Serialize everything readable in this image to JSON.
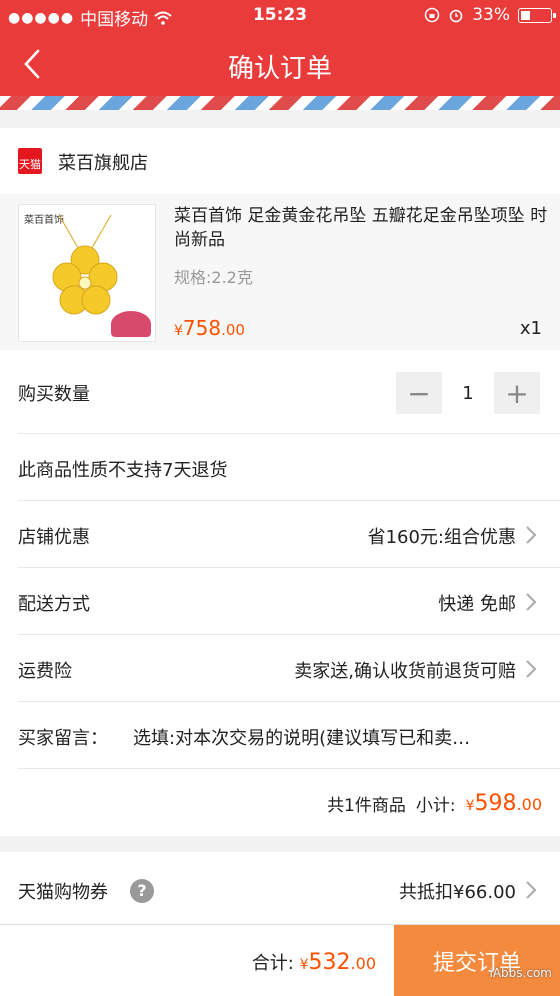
{
  "status_bar": {
    "carrier": "中国移动",
    "time": "15:23",
    "battery": "33%"
  },
  "nav": {
    "title": "确认订单"
  },
  "shop": {
    "badge": "天猫",
    "name": "菜百旗舰店"
  },
  "product": {
    "thumb_brand": "菜百首饰",
    "title": "菜百首饰 足金黄金花吊坠 五瓣花足金吊坠项坠 时尚新品",
    "spec": "规格:2.2克",
    "price_symbol": "¥",
    "price_int": "758",
    "price_dec": ".00",
    "quantity": "x1"
  },
  "rows": {
    "buy_qty_label": "购买数量",
    "buy_qty_value": "1",
    "minus": "−",
    "plus": "+",
    "no_return": "此商品性质不支持7天退货",
    "discount_label": "店铺优惠",
    "discount_value": "省160元:组合优惠",
    "shipping_label": "配送方式",
    "shipping_value": "快递 免邮",
    "insurance_label": "运费险",
    "insurance_value": "卖家送,确认收货前退货可赔",
    "message_label": "买家留言：",
    "message_placeholder": "选填:对本次交易的说明(建议填写已和卖…"
  },
  "subtotal": {
    "count": "共1件商品",
    "label": "小计:",
    "symbol": "¥",
    "int": "598",
    "dec": ".00"
  },
  "coupon": {
    "label": "天猫购物券",
    "help": "?",
    "value": "共抵扣¥66.00"
  },
  "bottom": {
    "total_label": "合计:",
    "symbol": "¥",
    "int": "532",
    "dec": ".00",
    "submit": "提交订单",
    "watermark": "iAbbs.com"
  },
  "colors": {
    "header_red": "#ea3b3b",
    "price_orange": "#ff5000",
    "submit_orange": "#f38a3d"
  }
}
